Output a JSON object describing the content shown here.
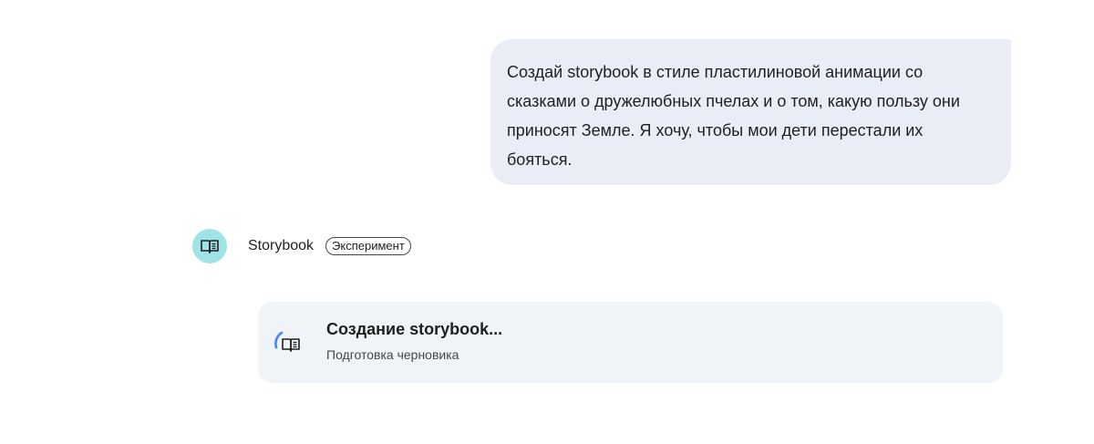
{
  "user_message": {
    "lines": [
      "Создай storybook в стиле пластилиновой анимации со",
      "сказками о дружелюбных пчелах и о том, какую пользу они",
      "приносят Земле. Я хочу, чтобы мои дети перестали их",
      "бояться."
    ]
  },
  "response": {
    "app_name": "Storybook",
    "badge": "Эксперимент",
    "avatar_icon": "open-book-icon",
    "avatar_color": "#9fe3e8"
  },
  "progress_card": {
    "title": "Создание storybook...",
    "subtitle": "Подготовка черновика",
    "icon": "loading-book-icon",
    "spinner_color": "#4285f4"
  }
}
